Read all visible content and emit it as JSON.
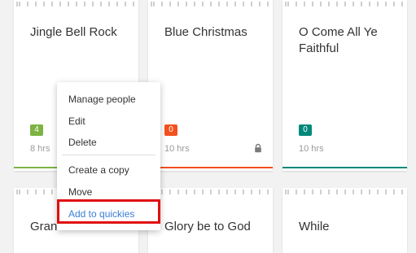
{
  "colors": {
    "green": "#7cb342",
    "orange": "#f4511e",
    "teal": "#00897b",
    "highlight_border": "#e01010",
    "link_blue": "#3b7dd8"
  },
  "cards": [
    {
      "title": "Jingle Bell Rock",
      "badge": "4",
      "hours": "8 hrs",
      "locked": false
    },
    {
      "title": "Blue Christmas",
      "badge": "0",
      "hours": "10 hrs",
      "locked": true
    },
    {
      "title": "O Come All Ye Faithful",
      "badge": "0",
      "hours": "10 hrs",
      "locked": false
    },
    {
      "title": "Grandma Got"
    },
    {
      "title": "Glory be to God"
    },
    {
      "title": "While"
    }
  ],
  "menu": {
    "items": [
      {
        "label": "Manage people"
      },
      {
        "label": "Edit"
      },
      {
        "label": "Delete"
      },
      {
        "label": "Create a copy"
      },
      {
        "label": "Move"
      },
      {
        "label": "Add to quickies"
      }
    ]
  },
  "icons": {
    "lock": "lock-icon"
  }
}
